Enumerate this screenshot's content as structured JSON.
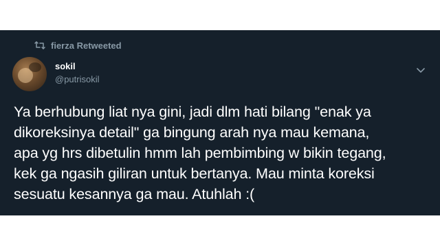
{
  "colors": {
    "background": "#15202b",
    "text": "#ffffff",
    "muted": "#8899a6",
    "page_background": "#ffffff"
  },
  "icons": {
    "retweet": "retweet-icon",
    "caret": "chevron-down-icon",
    "avatar": "avatar"
  },
  "tweet": {
    "retweeted_by": "fierza Retweeted",
    "display_name": "sokil",
    "handle": "@putrisokil",
    "lines": [
      "Ya berhubung liat nya gini, jadi dlm hati bilang \"enak ya",
      "dikoreksinya detail\" ga bingung arah nya mau kemana,",
      "apa yg hrs dibetulin hmm lah pembimbing w bikin tegang,",
      "kek ga ngasih giliran untuk bertanya. Mau minta koreksi",
      "sesuatu kesannya ga mau. Atuhlah :("
    ]
  }
}
